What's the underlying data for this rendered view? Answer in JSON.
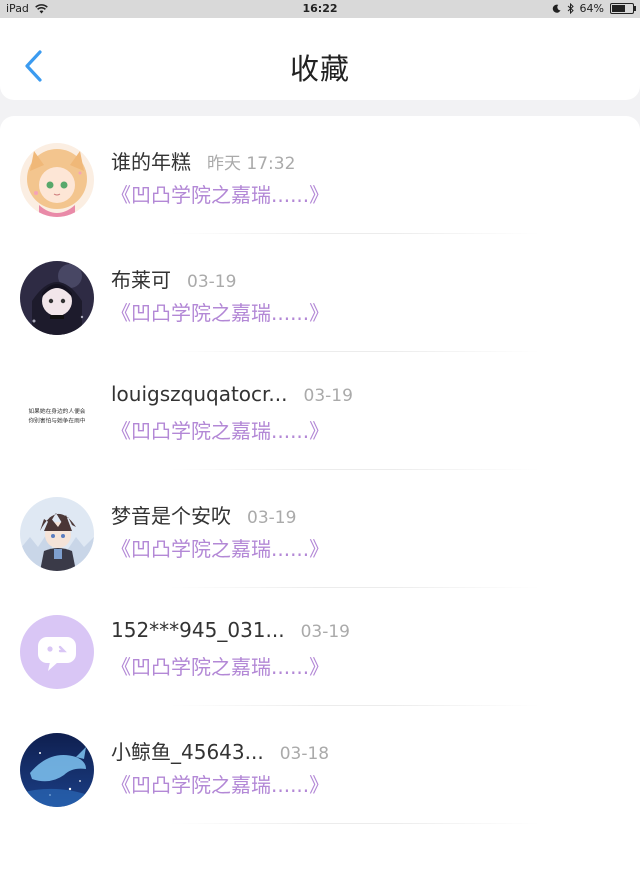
{
  "statusbar": {
    "device": "iPad",
    "time": "16:22",
    "battery": "64%",
    "battery_level": 0.64
  },
  "header": {
    "title": "收藏",
    "back_icon": "chevron-left-icon"
  },
  "items": [
    {
      "name": "谁的年糕",
      "time": "昨天 17:32",
      "link": "《凹凸学院之嘉瑞......》"
    },
    {
      "name": "布莱可",
      "time": "03-19",
      "link": "《凹凸学院之嘉瑞......》"
    },
    {
      "name": "louigszquqatocr...",
      "time": "03-19",
      "link": "《凹凸学院之嘉瑞......》",
      "avatar_text": [
        "如果她在身边的人便会",
        "你别害怕与她争在雨中"
      ]
    },
    {
      "name": "梦音是个安吹",
      "time": "03-19",
      "link": "《凹凸学院之嘉瑞......》"
    },
    {
      "name": "152***945_031...",
      "time": "03-19",
      "link": "《凹凸学院之嘉瑞......》"
    },
    {
      "name": "小鲸鱼_45643...",
      "time": "03-18",
      "link": "《凹凸学院之嘉瑞......》"
    }
  ],
  "colors": {
    "accent": "#3b9bf0",
    "link": "#b388d6",
    "default_avatar": "#d9c6f5"
  }
}
